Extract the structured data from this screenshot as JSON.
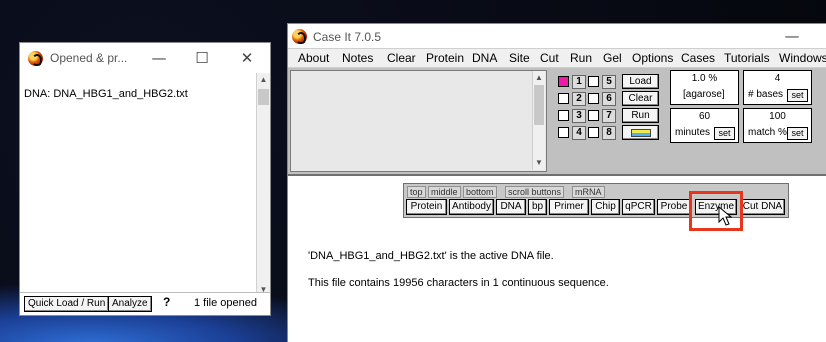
{
  "small_window": {
    "title": "Opened & pr...",
    "content_line": "DNA: DNA_HBG1_and_HBG2.txt",
    "quick_load_label": "Quick Load / Run",
    "analyze_label": "Analyze",
    "help_label": "?",
    "status_text": "1 file opened"
  },
  "main_window": {
    "title": "Case It 7.0.5",
    "menu": [
      "About",
      "Notes",
      "Clear",
      "Protein",
      "DNA",
      "Site",
      "Cut",
      "Run",
      "Gel",
      "Options",
      "Cases",
      "Tutorials",
      "Windows"
    ],
    "lanes": [
      {
        "left": "1",
        "right": "5",
        "checked": true
      },
      {
        "left": "2",
        "right": "6",
        "checked": false
      },
      {
        "left": "3",
        "right": "7",
        "checked": false
      },
      {
        "left": "4",
        "right": "8",
        "checked": false
      }
    ],
    "buttons": {
      "load": "Load",
      "clear": "Clear",
      "run": "Run"
    },
    "params": [
      {
        "value": "1.0 %",
        "label": "[agarose]",
        "set": ""
      },
      {
        "value": "4",
        "label": "# bases",
        "set": "set"
      },
      {
        "value": "60",
        "label": "minutes",
        "set": "set"
      },
      {
        "value": "100",
        "label": "match %",
        "set": "set"
      }
    ],
    "palette_tabs": [
      "top",
      "middle",
      "bottom",
      "scroll buttons",
      "mRNA"
    ],
    "palette_buttons": [
      "Protein",
      "Antibody",
      "DNA",
      "bp",
      "Primer",
      "Chip",
      "qPCR",
      "Probe",
      "Enzyme",
      "Cut DNA"
    ],
    "message_lines": [
      "'DNA_HBG1_and_HBG2.txt' is the active DNA file.",
      "This file contains 19956 characters in 1 continuous sequence."
    ]
  },
  "colors": {
    "highlight": "#e8361c",
    "lane_checked": "#ee1aa8"
  }
}
